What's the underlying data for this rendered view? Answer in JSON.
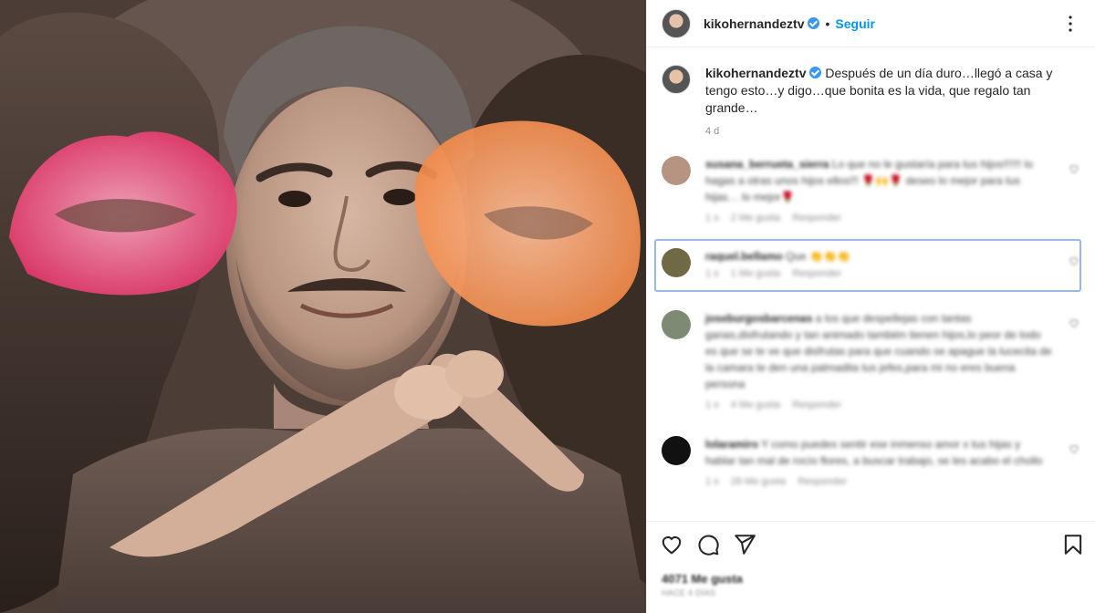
{
  "post": {
    "username": "kikohernandeztv",
    "follow_label": "Seguir",
    "separator": "•",
    "caption_user": "kikohernandeztv",
    "caption_text": "Después de un día duro…llegó a casa y tengo esto…y digo…que bonita es la vida, que regalo tan grande…",
    "caption_age": "4 d"
  },
  "comments": [
    {
      "user": "susana_berrueta_sierra",
      "text": "Lo que no le gustaría para tus hijos!!!!!! lo hagas a otras unos hijos ellos!!! 🌹🙌🌹 deseo lo mejor para tus hijas… lo mejor🌹",
      "age": "1 s",
      "likes": "2 Me gusta",
      "reply": "Responder",
      "avatar_color": "#b79382"
    },
    {
      "user": "raquel.bellamo",
      "text": "Que 👏👏👏",
      "age": "1 s",
      "likes": "1 Me gusta",
      "reply": "Responder",
      "avatar_color": "#6f6a45"
    },
    {
      "user": "joseburgosbarcenas",
      "text": "a los que despellejas con tantas ganas,disfrutando y tan animado también tienen hijos,lo peor de todo es que se te ve que disfrutas para que cuando se apague la lucecita de la camara te den una palmadita tus jefes,para mi no eres buena persona",
      "age": "1 s",
      "likes": "4 Me gusta",
      "reply": "Responder",
      "avatar_color": "#7d8a74"
    },
    {
      "user": "lolaramiro",
      "text": "Y como puedes sentir ese inmenso amor x tus hijas y hablar tan mal de rocío flores, a buscar trabajo, se les acabo el chollo",
      "age": "1 s",
      "likes": "28 Me gusta",
      "reply": "Responder",
      "avatar_color": "#111111"
    }
  ],
  "footer": {
    "likes": "4071 Me gusta",
    "date": "HACE 4 DÍAS"
  },
  "colors": {
    "accent": "#0095f6",
    "verified": "#3897f0",
    "highlight": "#9ab7e8"
  },
  "icons": [
    "more-options-icon",
    "verified-icon",
    "heart-icon",
    "comment-icon",
    "share-icon",
    "bookmark-icon"
  ]
}
